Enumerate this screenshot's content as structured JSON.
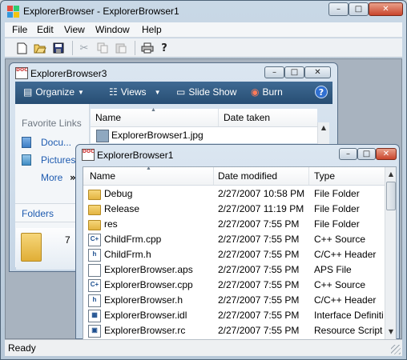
{
  "app": {
    "title": "ExplorerBrowser - ExplorerBrowser1",
    "min_glyph": "–",
    "max_glyph": "□",
    "close_glyph": "✕"
  },
  "menu": [
    "File",
    "Edit",
    "View",
    "Window",
    "Help"
  ],
  "toolbar_icons": [
    "new-file-icon",
    "open-folder-icon",
    "save-icon",
    "cut-icon",
    "copy-icon",
    "paste-icon",
    "print-icon",
    "help-icon"
  ],
  "status": {
    "text": "Ready"
  },
  "window3": {
    "title": "ExplorerBrowser3",
    "commands": {
      "organize": "Organize",
      "views": "Views",
      "slideshow": "Slide Show",
      "burn": "Burn"
    },
    "favorites_title": "Favorite Links",
    "links": [
      "Docu...",
      "Pictures",
      "More"
    ],
    "more_arrows": "»",
    "folders_label": "Folders",
    "header": {
      "name": "Name",
      "date_taken": "Date taken"
    },
    "file": "ExplorerBrowser1.jpg",
    "count": "7"
  },
  "window1": {
    "title": "ExplorerBrowser1",
    "header": {
      "name": "Name",
      "date": "Date modified",
      "type": "Type"
    },
    "rows": [
      {
        "name": "Debug",
        "date": "2/27/2007 10:58 PM",
        "type": "File Folder",
        "icon": "folder"
      },
      {
        "name": "Release",
        "date": "2/27/2007 11:19 PM",
        "type": "File Folder",
        "icon": "folder"
      },
      {
        "name": "res",
        "date": "2/27/2007 7:55 PM",
        "type": "File Folder",
        "icon": "folder"
      },
      {
        "name": "ChildFrm.cpp",
        "date": "2/27/2007 7:55 PM",
        "type": "C++ Source",
        "icon": "cpp"
      },
      {
        "name": "ChildFrm.h",
        "date": "2/27/2007 7:55 PM",
        "type": "C/C++ Header",
        "icon": "h"
      },
      {
        "name": "ExplorerBrowser.aps",
        "date": "2/27/2007 7:55 PM",
        "type": "APS File",
        "icon": "file"
      },
      {
        "name": "ExplorerBrowser.cpp",
        "date": "2/27/2007 7:55 PM",
        "type": "C++ Source",
        "icon": "cpp"
      },
      {
        "name": "ExplorerBrowser.h",
        "date": "2/27/2007 7:55 PM",
        "type": "C/C++ Header",
        "icon": "h"
      },
      {
        "name": "ExplorerBrowser.idl",
        "date": "2/27/2007 7:55 PM",
        "type": "Interface Definiti",
        "icon": "idl"
      },
      {
        "name": "ExplorerBrowser.rc",
        "date": "2/27/2007 7:55 PM",
        "type": "Resource Script",
        "icon": "rc"
      }
    ]
  }
}
